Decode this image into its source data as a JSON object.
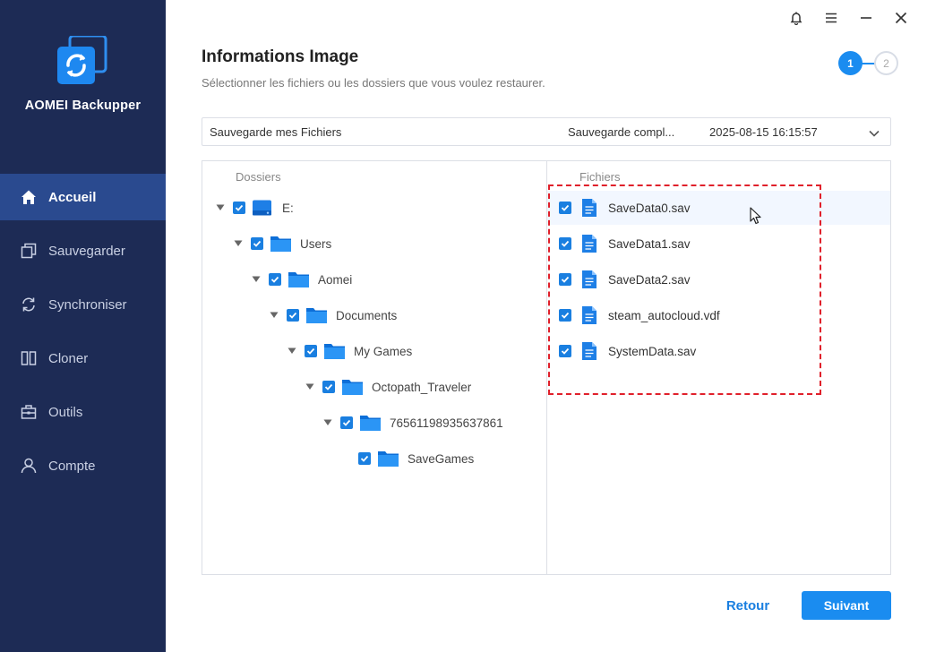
{
  "app": {
    "name": "AOMEI Backupper"
  },
  "sidebar": {
    "items": [
      {
        "label": "Accueil",
        "icon": "home-icon",
        "active": true
      },
      {
        "label": "Sauvegarder",
        "icon": "backup-icon",
        "active": false
      },
      {
        "label": "Synchroniser",
        "icon": "sync-icon",
        "active": false
      },
      {
        "label": "Cloner",
        "icon": "clone-icon",
        "active": false
      },
      {
        "label": "Outils",
        "icon": "tools-icon",
        "active": false
      },
      {
        "label": "Compte",
        "icon": "user-icon",
        "active": false
      }
    ]
  },
  "header": {
    "title": "Informations Image",
    "subtitle": "Sélectionner les fichiers ou les dossiers que vous voulez restaurer."
  },
  "steps": {
    "current": "1",
    "next": "2"
  },
  "backup": {
    "name": "Sauvegarde mes Fichiers",
    "type": "Sauvegarde compl...",
    "date": "2025-08-15 16:15:57"
  },
  "folders": {
    "header": "Dossiers",
    "items": [
      {
        "label": "E:",
        "kind": "drive",
        "level": 0,
        "expanded": true,
        "checked": true
      },
      {
        "label": "Users",
        "kind": "folder",
        "level": 1,
        "expanded": true,
        "checked": true
      },
      {
        "label": "Aomei",
        "kind": "folder",
        "level": 2,
        "expanded": true,
        "checked": true
      },
      {
        "label": "Documents",
        "kind": "folder",
        "level": 3,
        "expanded": true,
        "checked": true
      },
      {
        "label": "My Games",
        "kind": "folder",
        "level": 4,
        "expanded": true,
        "checked": true
      },
      {
        "label": "Octopath_Traveler",
        "kind": "folder",
        "level": 5,
        "expanded": true,
        "checked": true
      },
      {
        "label": "76561198935637861",
        "kind": "folder",
        "level": 6,
        "expanded": true,
        "checked": true
      },
      {
        "label": "SaveGames",
        "kind": "folder",
        "level": 7,
        "expanded": false,
        "checked": true
      }
    ]
  },
  "files": {
    "header": "Fichiers",
    "items": [
      {
        "label": "SaveData0.sav",
        "checked": true
      },
      {
        "label": "SaveData1.sav",
        "checked": true
      },
      {
        "label": "SaveData2.sav",
        "checked": true
      },
      {
        "label": "steam_autocloud.vdf",
        "checked": true
      },
      {
        "label": "SystemData.sav",
        "checked": true
      }
    ]
  },
  "footer": {
    "back_label": "Retour",
    "next_label": "Suivant"
  },
  "colors": {
    "sidebar": "#1d2b55",
    "active": "#2a4a8f",
    "accent": "#1a8cf0",
    "highlight": "#e0202b"
  }
}
